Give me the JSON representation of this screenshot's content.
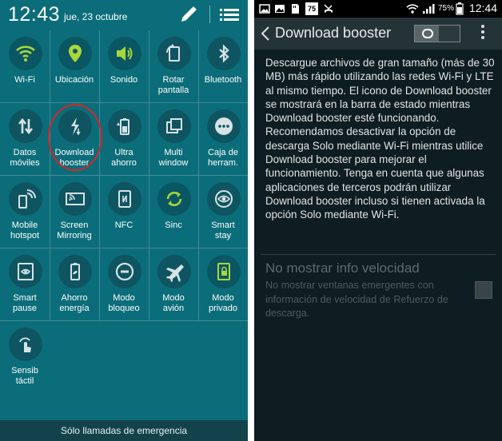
{
  "left_panel": {
    "time": "12:43",
    "date": "jue, 23 octubre",
    "icons": {
      "edit": "pencil-icon",
      "list": "list-icon"
    },
    "tiles": [
      {
        "label": "Wi-Fi",
        "icon": "wifi-icon",
        "on": true
      },
      {
        "label": "Ubicación",
        "icon": "location-icon",
        "on": true
      },
      {
        "label": "Sonido",
        "icon": "speaker-icon",
        "on": true
      },
      {
        "label": "Rotar\npantalla",
        "icon": "rotate-screen-icon",
        "on": false
      },
      {
        "label": "Bluetooth",
        "icon": "bluetooth-icon",
        "on": false
      },
      {
        "label": "Datos\nmóviles",
        "icon": "mobile-data-icon",
        "on": false
      },
      {
        "label": "Download\nbooster",
        "icon": "download-booster-icon",
        "on": false
      },
      {
        "label": "Ultra\nahorro",
        "icon": "ultra-power-saving-icon",
        "on": false
      },
      {
        "label": "Multi\nwindow",
        "icon": "multi-window-icon",
        "on": false
      },
      {
        "label": "Caja de\nherram.",
        "icon": "toolbox-icon",
        "on": false
      },
      {
        "label": "Mobile\nhotspot",
        "icon": "hotspot-icon",
        "on": false
      },
      {
        "label": "Screen\nMirroring",
        "icon": "screen-mirroring-icon",
        "on": false
      },
      {
        "label": "NFC",
        "icon": "nfc-icon",
        "on": false
      },
      {
        "label": "Sinc",
        "icon": "sync-icon",
        "on": true
      },
      {
        "label": "Smart\nstay",
        "icon": "smart-stay-icon",
        "on": false
      },
      {
        "label": "Smart\npause",
        "icon": "smart-pause-icon",
        "on": false
      },
      {
        "label": "Ahorro\nenergía",
        "icon": "power-saving-icon",
        "on": false
      },
      {
        "label": "Modo\nbloqueo",
        "icon": "blocking-mode-icon",
        "on": false
      },
      {
        "label": "Modo\navión",
        "icon": "airplane-icon",
        "on": false
      },
      {
        "label": "Modo\nprivado",
        "icon": "private-mode-icon",
        "on": true
      },
      {
        "label": "Sensib\ntáctil",
        "icon": "touch-sensitivity-icon",
        "on": false
      }
    ],
    "emergency_text": "Sólo llamadas de emergencia",
    "colors": {
      "background": "#0b6d79",
      "active_icon": "#a9d63b",
      "inactive_icon": "#d8e3e5",
      "highlight": "#d3262a"
    }
  },
  "right_panel": {
    "status_bar": {
      "time": "12:44",
      "battery_pct": "75%",
      "icons": [
        "image-icon",
        "mountain-icon",
        "sd-card-icon",
        "calendar-75-icon",
        "missed-call-icon",
        "wifi-icon",
        "signal-icon",
        "battery-icon"
      ],
      "calendar_day": "75"
    },
    "title": "Download booster",
    "toggle_state": "off",
    "description": "Descargue archivos de gran tamaño (más de 30 MB) más rápido utilizando las redes Wi-Fi y LTE al mismo tiempo. El icono de Download booster se mostrará en la barra de estado mientras Download booster esté funcionando. Recomendamos desactivar la opción de descarga Solo mediante Wi-Fi mientras utilice Download booster para mejorar el funcionamiento. Tenga en cuenta que algunas aplicaciones de terceros podrán utilizar Download booster incluso si tienen activada la opción Solo mediante Wi-Fi.",
    "option": {
      "title": "No mostrar info velocidad",
      "subtitle": "No mostrar ventanas emergentes con información de velocidad de Refuerzo de descarga.",
      "checked": false,
      "enabled": false
    },
    "colors": {
      "background": "#0d1d22",
      "actionbar": "#243336"
    }
  }
}
